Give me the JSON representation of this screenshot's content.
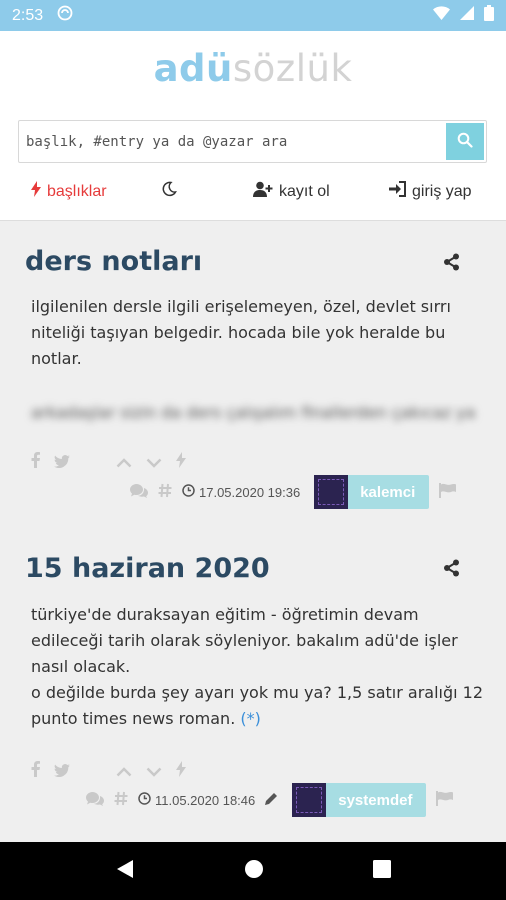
{
  "status": {
    "time": "2:53"
  },
  "logo": {
    "part1": "adü",
    "part2": "sözlük"
  },
  "search": {
    "placeholder": "başlık, #entry ya da @yazar ara"
  },
  "nav": {
    "topics": "başlıklar",
    "register": "kayıt ol",
    "login": "giriş yap"
  },
  "entries": [
    {
      "title": "ders notları",
      "lines": [
        "ilgilenilen dersle ilgili erişelemeyen, özel, devlet sırrı",
        "niteliği taşıyan belgedir. hocada bile yok heralde bu",
        "notlar."
      ],
      "blurred": "arkadaşlar sizin da ders çalışalım finallerden çakıcaz ya",
      "date": "17.05.2020 19:36",
      "author": "kalemci"
    },
    {
      "title": "15 haziran 2020",
      "lines": [
        "türkiye'de duraksayan eğitim - öğretimin devam",
        "edileceği tarih olarak söyleniyor. bakalım adü'de işler",
        "nasıl olacak.",
        "o değilde burda şey ayarı yok mu ya? 1,5 satır aralığı 12",
        "punto times news roman."
      ],
      "ref": "(*)",
      "date": "11.05.2020 18:46",
      "author": "systemdef"
    }
  ]
}
